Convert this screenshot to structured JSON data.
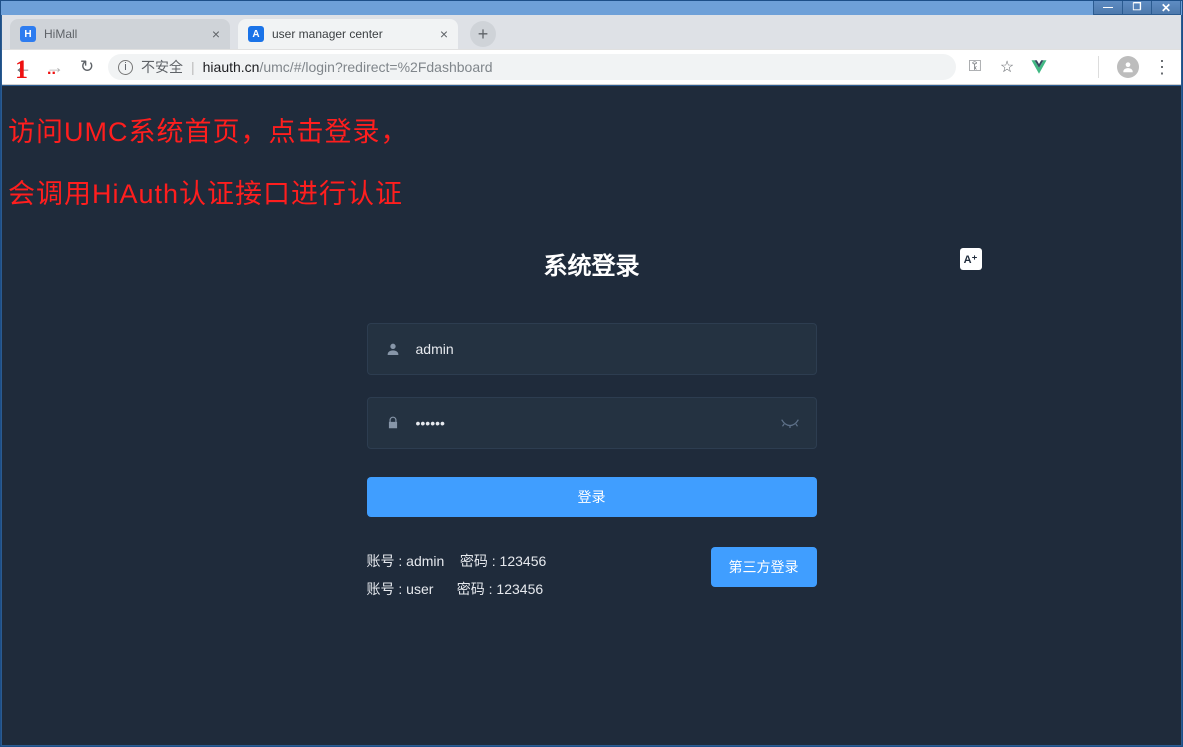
{
  "window": {
    "min": "—",
    "max": "❐",
    "close": "✕"
  },
  "browser": {
    "tabs": [
      {
        "favicon": "H",
        "title": "HiMall",
        "active": false
      },
      {
        "favicon": "A",
        "title": "user manager center",
        "active": true
      }
    ],
    "new_tab": "+",
    "nav": {
      "back": "←",
      "forward": "→",
      "reload": "↻"
    },
    "insecure_label": "不安全",
    "url_host": "hiauth.cn",
    "url_path": "/umc/#/login?redirect=%2Fdashboard",
    "icons": {
      "key": "⚿",
      "star": "☆",
      "profile": "👤",
      "menu": "⋮",
      "lang": "A⁺"
    }
  },
  "annotation": {
    "mark": "1",
    "line1": "访问UMC系统首页，点击登录，",
    "line2": "会调用HiAuth认证接口进行认证"
  },
  "login": {
    "title": "系统登录",
    "username_value": "admin",
    "password_value": "••••••",
    "login_button": "登录",
    "hints": {
      "l1_left": "账号 : admin",
      "l1_right": "密码 : 123456",
      "l2_left": "账号 : user",
      "l2_right": "密码 : 123456"
    },
    "third_party_button": "第三方登录"
  }
}
